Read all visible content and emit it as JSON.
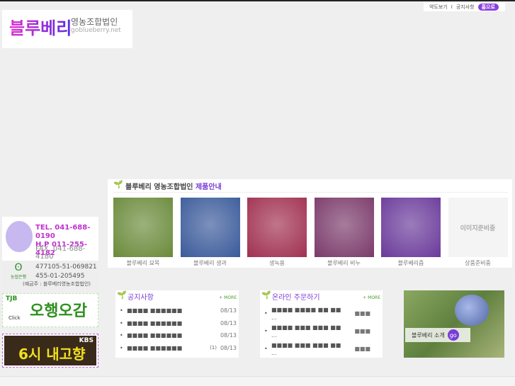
{
  "topnav": {
    "map": "약도보기",
    "sep": "I",
    "notice": "공지사항",
    "home": "홈으로"
  },
  "logo": {
    "name": "블루베리",
    "corp": "영농조합법인",
    "url": "goblueberry.net"
  },
  "products": {
    "title_main": "블루베리 영농조합법인",
    "title_hl": "제품안내",
    "items": [
      {
        "label": "블루베리 묘목",
        "color": "#6a8a3a"
      },
      {
        "label": "블루베리 생과",
        "color": "#3a5a9a"
      },
      {
        "label": "생녹용",
        "color": "#a03050"
      },
      {
        "label": "블루베리 비누",
        "color": "#7a3a6a"
      },
      {
        "label": "블루베리즙",
        "color": "#6a3a9a"
      },
      {
        "label": "상품준비중",
        "placeholder": "이미지준비중",
        "color": "#f4f4f4"
      }
    ]
  },
  "ads": {
    "tel": "TEL. 041-688-0190",
    "hp": "H.P  011-255-4182",
    "fax": "FAX. 041-688-4180",
    "bank": "농협은행",
    "acc1": "477105-51-069821",
    "acc2": "455-01-205495",
    "owner": "(예금주 : 블루베리영농조합법인)",
    "tjb": "TJB",
    "click": "Click",
    "show1": "오행오감",
    "kbs": "KBS",
    "show2": "6시 내고향"
  },
  "notice": {
    "title": "공지사항",
    "more": "+ MORE",
    "items": [
      {
        "text": "■■■■ ■■■■■■",
        "date": "08/13"
      },
      {
        "text": "■■■■ ■■■■■■",
        "date": "08/13"
      },
      {
        "text": "■■■■ ■■■■■■",
        "date": "08/13"
      },
      {
        "text": "■■■■ ■■■■■■",
        "count": "(1)",
        "date": "08/13"
      }
    ]
  },
  "order": {
    "title": "온라인 주문하기",
    "more": "+ MORE",
    "items": [
      {
        "text": "■■■■ ■■■■ ■■ ■■ ...",
        "status": "■■■"
      },
      {
        "text": "■■■■ ■■■ ■■■ ■■ ...",
        "status": "■■■"
      },
      {
        "text": "■■■■ ■■■ ■■■ ■■ ...",
        "status": "■■■"
      }
    ]
  },
  "intro": {
    "label": "블루베리 소개",
    "go": "go"
  }
}
